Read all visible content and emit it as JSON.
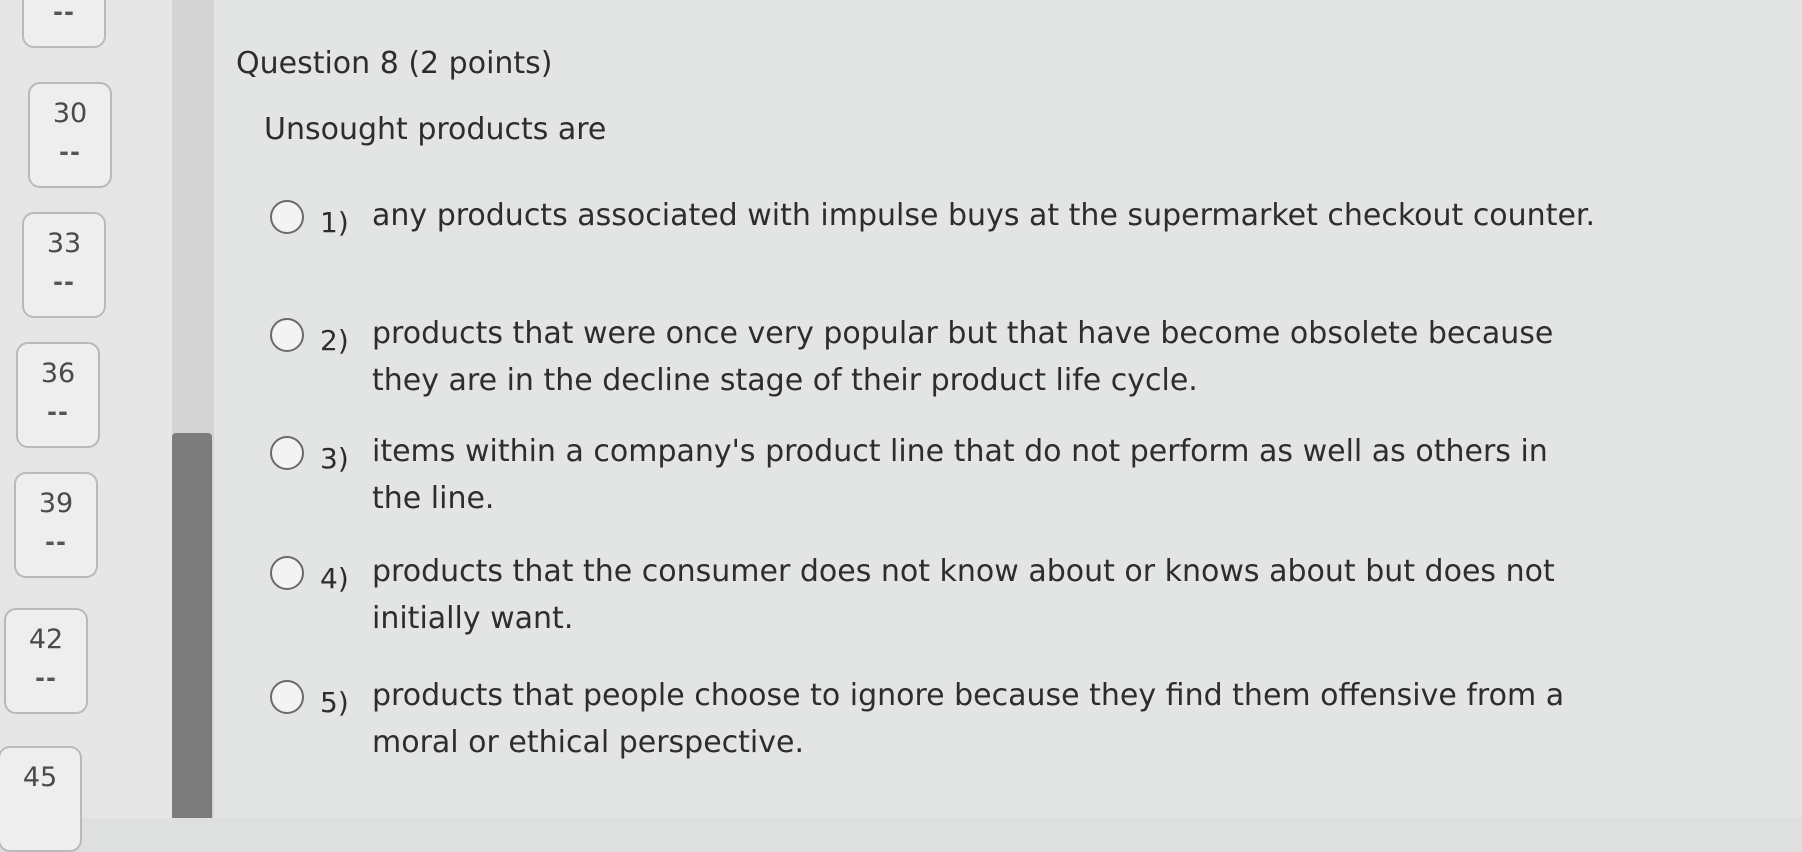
{
  "nav": {
    "items": [
      {
        "number": "",
        "status": "--"
      },
      {
        "number": "30",
        "status": "--"
      },
      {
        "number": "33",
        "status": "--"
      },
      {
        "number": "36",
        "status": "--"
      },
      {
        "number": "39",
        "status": "--"
      },
      {
        "number": "42",
        "status": "--"
      },
      {
        "number": "45",
        "status": ""
      }
    ]
  },
  "question": {
    "title": "Question 8 (2 points)",
    "prompt": "Unsought products are",
    "options": [
      {
        "num": "1)",
        "text": "any products associated with impulse buys at the supermarket checkout counter."
      },
      {
        "num": "2)",
        "text": "products that were once very popular but that have become obsolete because they are in the decline stage of their product life cycle."
      },
      {
        "num": "3)",
        "text": "items within a company's product line that do not perform as well as others in the line."
      },
      {
        "num": "4)",
        "text": "products that the consumer does not know about or knows about but does not initially want."
      },
      {
        "num": "5)",
        "text": "products that people choose to ignore because they find them offensive from a moral or ethical perspective."
      }
    ]
  }
}
